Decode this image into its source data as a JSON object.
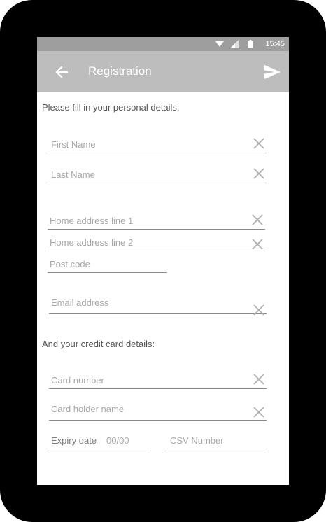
{
  "status_bar": {
    "time": "15:45",
    "icons": [
      "wifi-icon",
      "signal-icon",
      "battery-icon"
    ]
  },
  "app_bar": {
    "title": "Registration",
    "back_icon": "arrow-left-icon",
    "send_icon": "send-icon"
  },
  "personal": {
    "heading": "Please fill in your personal details.",
    "first_name": {
      "placeholder": "First Name",
      "value": ""
    },
    "last_name": {
      "placeholder": "Last Name",
      "value": ""
    },
    "address1": {
      "placeholder": "Home address line 1",
      "value": ""
    },
    "address2": {
      "placeholder": "Home address line 2",
      "value": ""
    },
    "postcode": {
      "placeholder": "Post code",
      "value": ""
    },
    "email": {
      "placeholder": "Email address",
      "value": ""
    }
  },
  "card": {
    "heading": "And your credit card details:",
    "number": {
      "placeholder": "Card number",
      "value": ""
    },
    "holder": {
      "placeholder": "Card holder name",
      "value": ""
    },
    "expiry": {
      "label": "Expiry date",
      "placeholder": "00/00",
      "value": ""
    },
    "csv": {
      "placeholder": "CSV Number",
      "value": ""
    }
  },
  "colors": {
    "app_bar": "#bdbdbd",
    "status_bar": "#9e9e9e",
    "text": "#555555",
    "placeholder": "#a8a8a8"
  }
}
